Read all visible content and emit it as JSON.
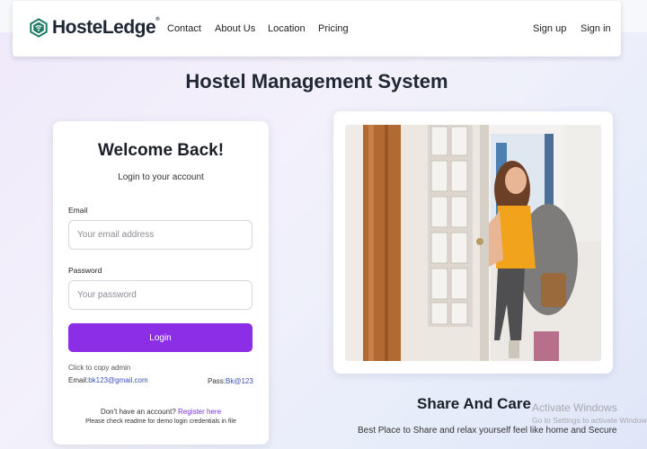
{
  "brand": {
    "name": "HosteLedge",
    "mark": "®",
    "logo_icon": "hexagon-wifi-logo-icon",
    "accent": "#1f7a66"
  },
  "nav": {
    "links": [
      "Contact",
      "About Us",
      "Location",
      "Pricing"
    ],
    "signup": "Sign up",
    "signin": "Sign in"
  },
  "page_title": "Hostel Management System",
  "login": {
    "heading": "Welcome Back!",
    "subtitle": "Login to your account",
    "email_label": "Email",
    "email_placeholder": "Your email address",
    "password_label": "Password",
    "password_placeholder": "Your password",
    "login_button": "Login",
    "button_color": "#8b2ee6",
    "copy_hint": "Click to copy admin",
    "demo_email_label": "Email:",
    "demo_email": "bk123@gmail.com",
    "demo_pass_label": "Pass:",
    "demo_pass": "Bk@123",
    "no_account": "Don't have an account?",
    "register_link": "Register here",
    "readme_note": "Please check readme for demo login credentials in file"
  },
  "feature": {
    "title": "Share And Care",
    "subtitle": "Best Place to Share and relax yourself feel like home and Secure",
    "image": "woman-with-backpack-opening-door-photo"
  },
  "watermark": {
    "line1": "Activate Windows",
    "line2": "Go to Settings to activate Windows."
  }
}
